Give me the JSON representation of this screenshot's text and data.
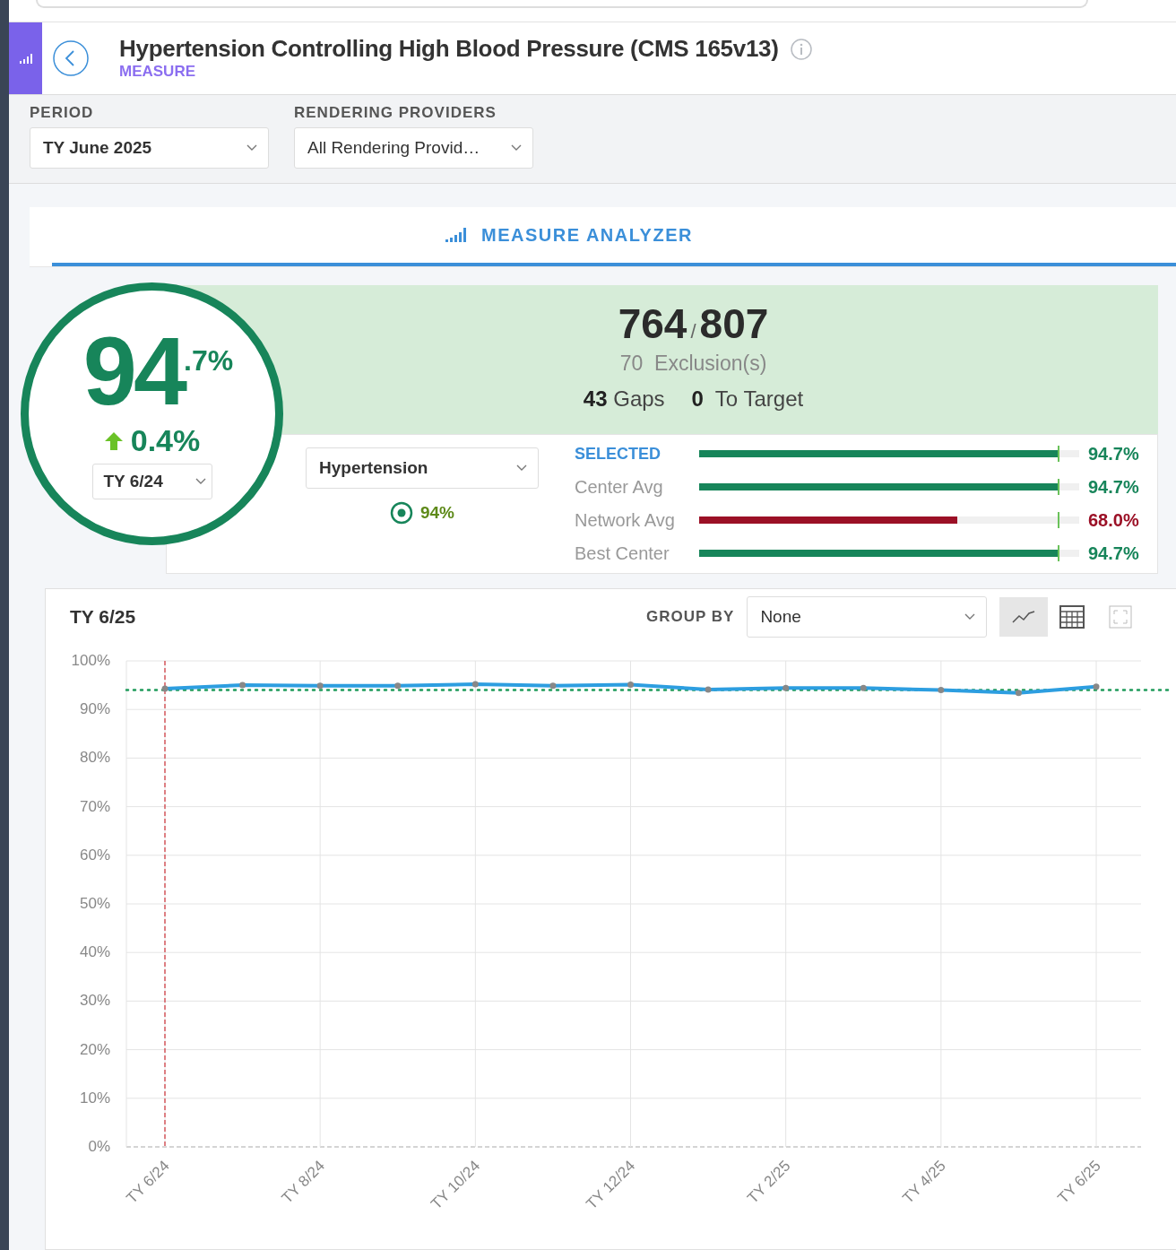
{
  "header": {
    "title": "Hypertension Controlling High Blood Pressure (CMS 165v13)",
    "subtitle": "MEASURE"
  },
  "filters": [
    {
      "label": "PERIOD",
      "value": "TY June 2025"
    },
    {
      "label": "RENDERING PROVIDERS",
      "value": "All Rendering Provid…"
    }
  ],
  "analyzer_tab": {
    "label": "MEASURE ANALYZER",
    "selected": true
  },
  "score": {
    "whole": "94",
    "fraction": ".7%",
    "change": "0.4%",
    "compare_period": "TY 6/24"
  },
  "summary": {
    "numerator": "764",
    "separator": "/",
    "denominator": "807",
    "exclusions_count": "70",
    "exclusions_label": "Exclusion(s)",
    "gaps_count": "43",
    "gaps_label": "Gaps",
    "to_target_count": "0",
    "to_target_label": "To Target"
  },
  "population": {
    "value": "Hypertension",
    "target": "94%"
  },
  "benchmarks": [
    {
      "label": "SELECTED",
      "selected": true,
      "level": 0.947,
      "value": "94.7%",
      "color": "#17855a"
    },
    {
      "label": "Center Avg",
      "selected": false,
      "level": 0.947,
      "value": "94.7%",
      "color": "#17855a"
    },
    {
      "label": "Network Avg",
      "selected": false,
      "level": 0.68,
      "value": "68.0%",
      "color": "#9b1026"
    },
    {
      "label": "Best Center",
      "selected": false,
      "level": 0.947,
      "value": "94.7%",
      "color": "#17855a"
    }
  ],
  "chart_panel": {
    "title": "TY 6/25",
    "group_by_label": "GROUP BY",
    "group_by_value": "None",
    "views": [
      {
        "kind": "line",
        "selected": true
      },
      {
        "kind": "table",
        "selected": false
      }
    ],
    "chart_data": {
      "type": "line",
      "categories": [
        "TY 6/24",
        null,
        "TY 8/24",
        null,
        "TY 10/24",
        null,
        "TY 12/24",
        null,
        "TY 2/25",
        null,
        "TY 4/25",
        null,
        "TY 6/25"
      ],
      "grid": true,
      "ref_lines": [
        {
          "axis": "y",
          "value": 94,
          "color": "#1e9a5a"
        },
        {
          "axis": "x",
          "value": "TY 6/24",
          "color": "#d0343a"
        }
      ],
      "series": [
        {
          "color": "#2d9ee0",
          "marker": true,
          "values": [
            94.3,
            95.0,
            94.9,
            94.9,
            95.2,
            94.9,
            95.1,
            94.1,
            94.4,
            94.4,
            94.0,
            93.4,
            94.7
          ]
        }
      ],
      "ylim": [
        0,
        100
      ],
      "yticks": [
        {
          "value": 0,
          "label": "0%"
        },
        {
          "value": 10,
          "label": "10%"
        },
        {
          "value": 20,
          "label": "20%"
        },
        {
          "value": 30,
          "label": "30%"
        },
        {
          "value": 40,
          "label": "40%"
        },
        {
          "value": 50,
          "label": "50%"
        },
        {
          "value": 60,
          "label": "60%"
        },
        {
          "value": 70,
          "label": "70%"
        },
        {
          "value": 80,
          "label": "80%"
        },
        {
          "value": 90,
          "label": "90%"
        },
        {
          "value": 100,
          "label": "100%"
        }
      ]
    }
  }
}
